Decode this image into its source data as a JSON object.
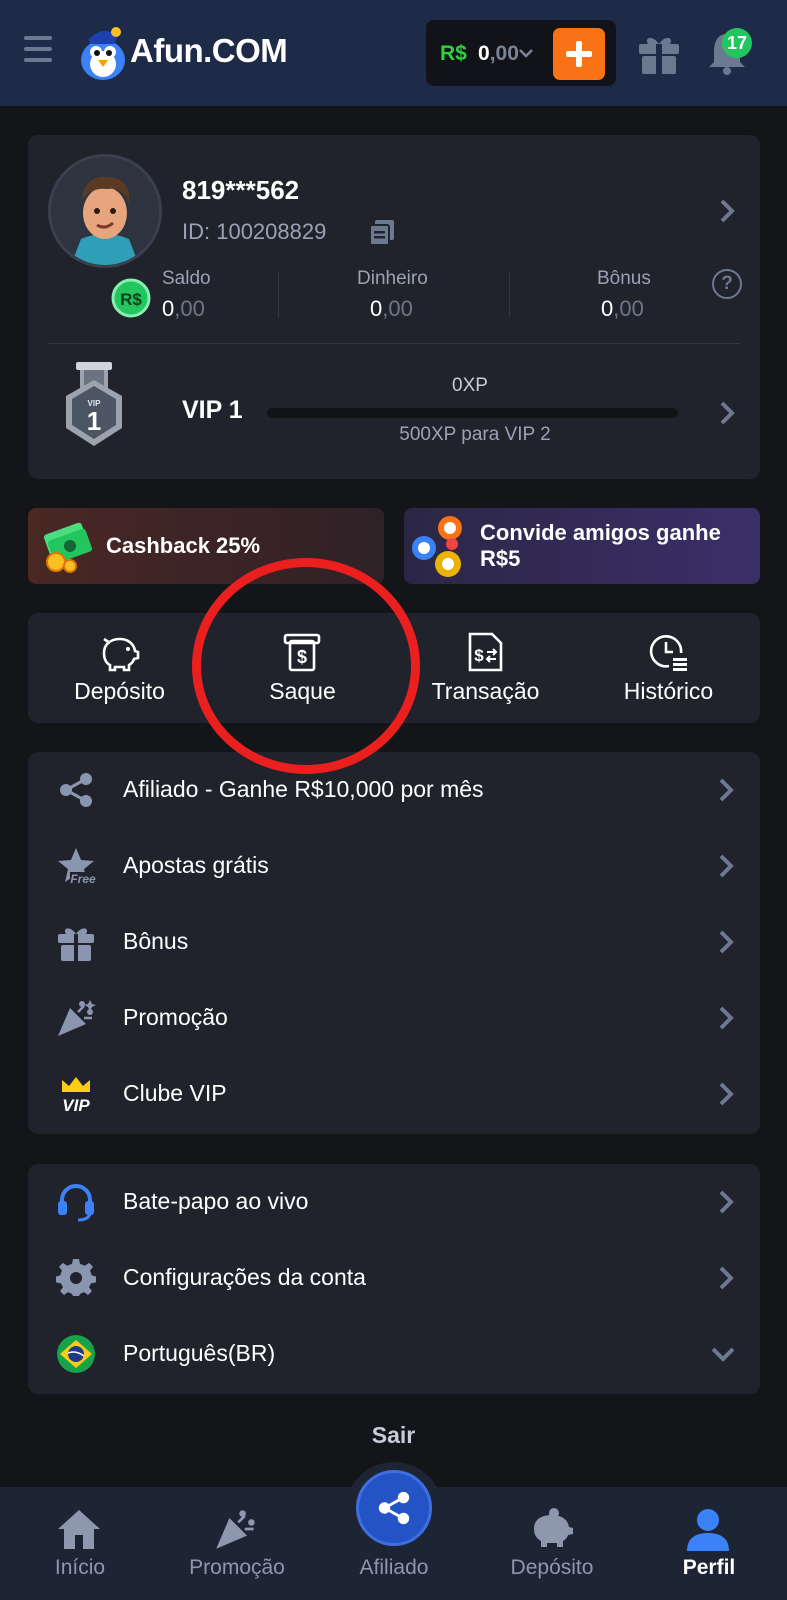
{
  "header": {
    "brand": "Afun.COM",
    "currency": "R$",
    "balance_int": "0",
    "balance_dec": ",00",
    "notifications": "17",
    "icons": [
      "menu-icon",
      "logo-icon",
      "chevron-down-icon",
      "plus-icon",
      "gift-icon",
      "bell-icon"
    ]
  },
  "profile": {
    "username": "819***562",
    "id_label": "ID: 100208829",
    "stats": [
      {
        "label": "Saldo",
        "int": "0",
        "dec": ",00"
      },
      {
        "label": "Dinheiro",
        "int": "0",
        "dec": ",00"
      },
      {
        "label": "Bônus",
        "int": "0",
        "dec": ",00"
      }
    ],
    "coin_text": "R$",
    "help": "?",
    "vip": {
      "badge_small": "VIP",
      "badge_level": "1",
      "label": "VIP 1",
      "xp": "0XP",
      "next": "500XP para VIP 2",
      "progress_percent": 0
    }
  },
  "promos": {
    "cashback": "Cashback 25%",
    "invite_line1": "Convide amigos ganhe",
    "invite_line2": "R$5"
  },
  "actions": [
    {
      "label": "Depósito",
      "icon": "piggy-bank-icon"
    },
    {
      "label": "Saque",
      "icon": "atm-withdraw-icon"
    },
    {
      "label": "Transação",
      "icon": "transaction-doc-icon"
    },
    {
      "label": "Histórico",
      "icon": "history-clock-icon"
    }
  ],
  "menu1": [
    {
      "label": "Afiliado - Ganhe R$10,000 por mês",
      "icon": "share-nodes-icon"
    },
    {
      "label": "Apostas grátis",
      "icon": "free-star-icon"
    },
    {
      "label": "Bônus",
      "icon": "gift-icon"
    },
    {
      "label": "Promoção",
      "icon": "party-popper-icon"
    },
    {
      "label": "Clube VIP",
      "icon": "vip-crown-icon"
    }
  ],
  "free_tag": "Free",
  "vip_tag": "VIP",
  "menu2": [
    {
      "label": "Bate-papo ao vivo",
      "icon": "headset-icon"
    },
    {
      "label": "Configurações da conta",
      "icon": "gear-icon"
    },
    {
      "label": "Português(BR)",
      "icon": "brazil-flag-icon"
    }
  ],
  "logout": "Sair",
  "nav": [
    {
      "label": "Início",
      "icon": "home-icon"
    },
    {
      "label": "Promoção",
      "icon": "party-popper-icon"
    },
    {
      "label": "Afiliado",
      "icon": "share-nodes-icon"
    },
    {
      "label": "Depósito",
      "icon": "piggy-bank-icon"
    },
    {
      "label": "Perfil",
      "icon": "user-icon"
    }
  ],
  "colors": {
    "header_bg": "#1d2a48",
    "page_bg": "#131519",
    "card_bg": "#20232b",
    "accent_orange": "#f97316",
    "accent_green": "#22c55e",
    "accent_blue": "#2453c6",
    "annotation_red": "#ec1f1f"
  }
}
